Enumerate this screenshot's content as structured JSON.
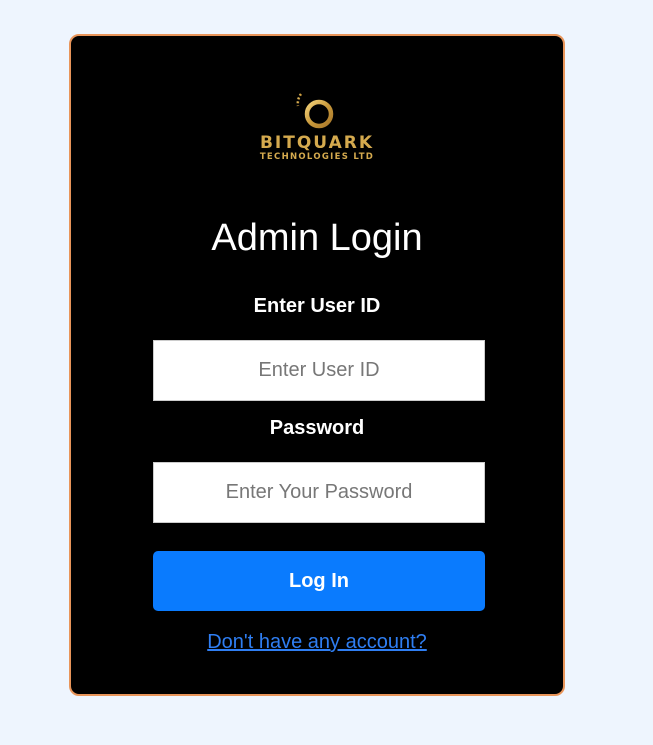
{
  "brand": {
    "name": "BITQUARK",
    "subtitle": "TECHNOLOGIES LTD",
    "logo_icon": "bitquark-logo-icon",
    "color": "#d5aa4e"
  },
  "login": {
    "title": "Admin Login",
    "user_label": "Enter User ID",
    "user_placeholder": "Enter User ID",
    "user_value": "",
    "password_label": "Password",
    "password_placeholder": "Enter Your Password",
    "password_value": "",
    "submit_label": "Log In",
    "signup_link_text": "Don't have any account?"
  },
  "colors": {
    "page_background": "#eef5fe",
    "card_background": "#000000",
    "card_border": "#e8955a",
    "button": "#0a7bfe",
    "link": "#2f7ef2"
  }
}
